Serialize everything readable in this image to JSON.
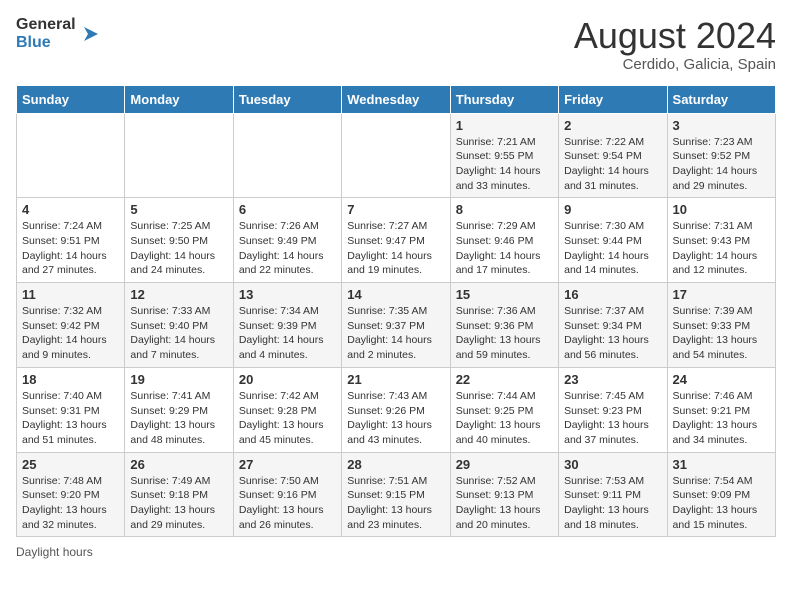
{
  "header": {
    "logo_general": "General",
    "logo_blue": "Blue",
    "title": "August 2024",
    "subtitle": "Cerdido, Galicia, Spain"
  },
  "weekdays": [
    "Sunday",
    "Monday",
    "Tuesday",
    "Wednesday",
    "Thursday",
    "Friday",
    "Saturday"
  ],
  "weeks": [
    [
      {
        "day": "",
        "info": ""
      },
      {
        "day": "",
        "info": ""
      },
      {
        "day": "",
        "info": ""
      },
      {
        "day": "",
        "info": ""
      },
      {
        "day": "1",
        "info": "Sunrise: 7:21 AM\nSunset: 9:55 PM\nDaylight: 14 hours\nand 33 minutes."
      },
      {
        "day": "2",
        "info": "Sunrise: 7:22 AM\nSunset: 9:54 PM\nDaylight: 14 hours\nand 31 minutes."
      },
      {
        "day": "3",
        "info": "Sunrise: 7:23 AM\nSunset: 9:52 PM\nDaylight: 14 hours\nand 29 minutes."
      }
    ],
    [
      {
        "day": "4",
        "info": "Sunrise: 7:24 AM\nSunset: 9:51 PM\nDaylight: 14 hours\nand 27 minutes."
      },
      {
        "day": "5",
        "info": "Sunrise: 7:25 AM\nSunset: 9:50 PM\nDaylight: 14 hours\nand 24 minutes."
      },
      {
        "day": "6",
        "info": "Sunrise: 7:26 AM\nSunset: 9:49 PM\nDaylight: 14 hours\nand 22 minutes."
      },
      {
        "day": "7",
        "info": "Sunrise: 7:27 AM\nSunset: 9:47 PM\nDaylight: 14 hours\nand 19 minutes."
      },
      {
        "day": "8",
        "info": "Sunrise: 7:29 AM\nSunset: 9:46 PM\nDaylight: 14 hours\nand 17 minutes."
      },
      {
        "day": "9",
        "info": "Sunrise: 7:30 AM\nSunset: 9:44 PM\nDaylight: 14 hours\nand 14 minutes."
      },
      {
        "day": "10",
        "info": "Sunrise: 7:31 AM\nSunset: 9:43 PM\nDaylight: 14 hours\nand 12 minutes."
      }
    ],
    [
      {
        "day": "11",
        "info": "Sunrise: 7:32 AM\nSunset: 9:42 PM\nDaylight: 14 hours\nand 9 minutes."
      },
      {
        "day": "12",
        "info": "Sunrise: 7:33 AM\nSunset: 9:40 PM\nDaylight: 14 hours\nand 7 minutes."
      },
      {
        "day": "13",
        "info": "Sunrise: 7:34 AM\nSunset: 9:39 PM\nDaylight: 14 hours\nand 4 minutes."
      },
      {
        "day": "14",
        "info": "Sunrise: 7:35 AM\nSunset: 9:37 PM\nDaylight: 14 hours\nand 2 minutes."
      },
      {
        "day": "15",
        "info": "Sunrise: 7:36 AM\nSunset: 9:36 PM\nDaylight: 13 hours\nand 59 minutes."
      },
      {
        "day": "16",
        "info": "Sunrise: 7:37 AM\nSunset: 9:34 PM\nDaylight: 13 hours\nand 56 minutes."
      },
      {
        "day": "17",
        "info": "Sunrise: 7:39 AM\nSunset: 9:33 PM\nDaylight: 13 hours\nand 54 minutes."
      }
    ],
    [
      {
        "day": "18",
        "info": "Sunrise: 7:40 AM\nSunset: 9:31 PM\nDaylight: 13 hours\nand 51 minutes."
      },
      {
        "day": "19",
        "info": "Sunrise: 7:41 AM\nSunset: 9:29 PM\nDaylight: 13 hours\nand 48 minutes."
      },
      {
        "day": "20",
        "info": "Sunrise: 7:42 AM\nSunset: 9:28 PM\nDaylight: 13 hours\nand 45 minutes."
      },
      {
        "day": "21",
        "info": "Sunrise: 7:43 AM\nSunset: 9:26 PM\nDaylight: 13 hours\nand 43 minutes."
      },
      {
        "day": "22",
        "info": "Sunrise: 7:44 AM\nSunset: 9:25 PM\nDaylight: 13 hours\nand 40 minutes."
      },
      {
        "day": "23",
        "info": "Sunrise: 7:45 AM\nSunset: 9:23 PM\nDaylight: 13 hours\nand 37 minutes."
      },
      {
        "day": "24",
        "info": "Sunrise: 7:46 AM\nSunset: 9:21 PM\nDaylight: 13 hours\nand 34 minutes."
      }
    ],
    [
      {
        "day": "25",
        "info": "Sunrise: 7:48 AM\nSunset: 9:20 PM\nDaylight: 13 hours\nand 32 minutes."
      },
      {
        "day": "26",
        "info": "Sunrise: 7:49 AM\nSunset: 9:18 PM\nDaylight: 13 hours\nand 29 minutes."
      },
      {
        "day": "27",
        "info": "Sunrise: 7:50 AM\nSunset: 9:16 PM\nDaylight: 13 hours\nand 26 minutes."
      },
      {
        "day": "28",
        "info": "Sunrise: 7:51 AM\nSunset: 9:15 PM\nDaylight: 13 hours\nand 23 minutes."
      },
      {
        "day": "29",
        "info": "Sunrise: 7:52 AM\nSunset: 9:13 PM\nDaylight: 13 hours\nand 20 minutes."
      },
      {
        "day": "30",
        "info": "Sunrise: 7:53 AM\nSunset: 9:11 PM\nDaylight: 13 hours\nand 18 minutes."
      },
      {
        "day": "31",
        "info": "Sunrise: 7:54 AM\nSunset: 9:09 PM\nDaylight: 13 hours\nand 15 minutes."
      }
    ]
  ],
  "footer": {
    "daylight_label": "Daylight hours"
  }
}
